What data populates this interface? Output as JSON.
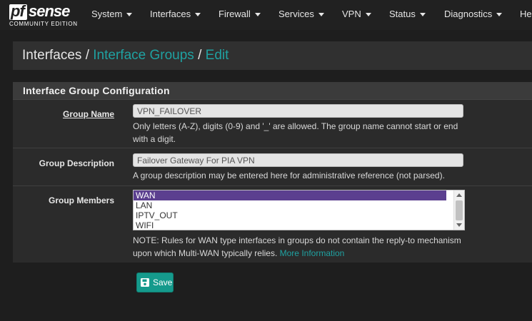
{
  "brand": {
    "name_pf": "pf",
    "name_sense": "sense",
    "edition": "COMMUNITY EDITION"
  },
  "nav": {
    "items": [
      {
        "label": "System"
      },
      {
        "label": "Interfaces"
      },
      {
        "label": "Firewall"
      },
      {
        "label": "Services"
      },
      {
        "label": "VPN"
      },
      {
        "label": "Status"
      },
      {
        "label": "Diagnostics"
      },
      {
        "label": "Hel"
      }
    ]
  },
  "breadcrumb": {
    "root": "Interfaces",
    "sep": " / ",
    "groups": "Interface Groups",
    "current": "Edit"
  },
  "panel": {
    "title": "Interface Group Configuration",
    "group_name": {
      "label": "Group Name",
      "value": "VPN_FAILOVER",
      "help": "Only letters (A-Z), digits (0-9) and '_' are allowed. The group name cannot start or end with a digit."
    },
    "group_description": {
      "label": "Group Description",
      "value": "Failover Gateway For PIA VPN",
      "help": "A group description may be entered here for administrative reference (not parsed)."
    },
    "group_members": {
      "label": "Group Members",
      "options": [
        "WAN",
        "LAN",
        "IPTV_OUT",
        "WIFI"
      ],
      "selected": "WAN",
      "note": "NOTE: Rules for WAN type interfaces in groups do not contain the reply-to mechanism upon which Multi-WAN typically relies.",
      "more_info": "More Information"
    }
  },
  "actions": {
    "save_label": "Save"
  },
  "icons": {
    "caret": "caret-down-icon",
    "save": "floppy-disk-icon"
  },
  "colors": {
    "accent": "#1fa1a1",
    "button": "#159a8c",
    "selected": "#5b3f8f",
    "navbar": "#212121"
  }
}
